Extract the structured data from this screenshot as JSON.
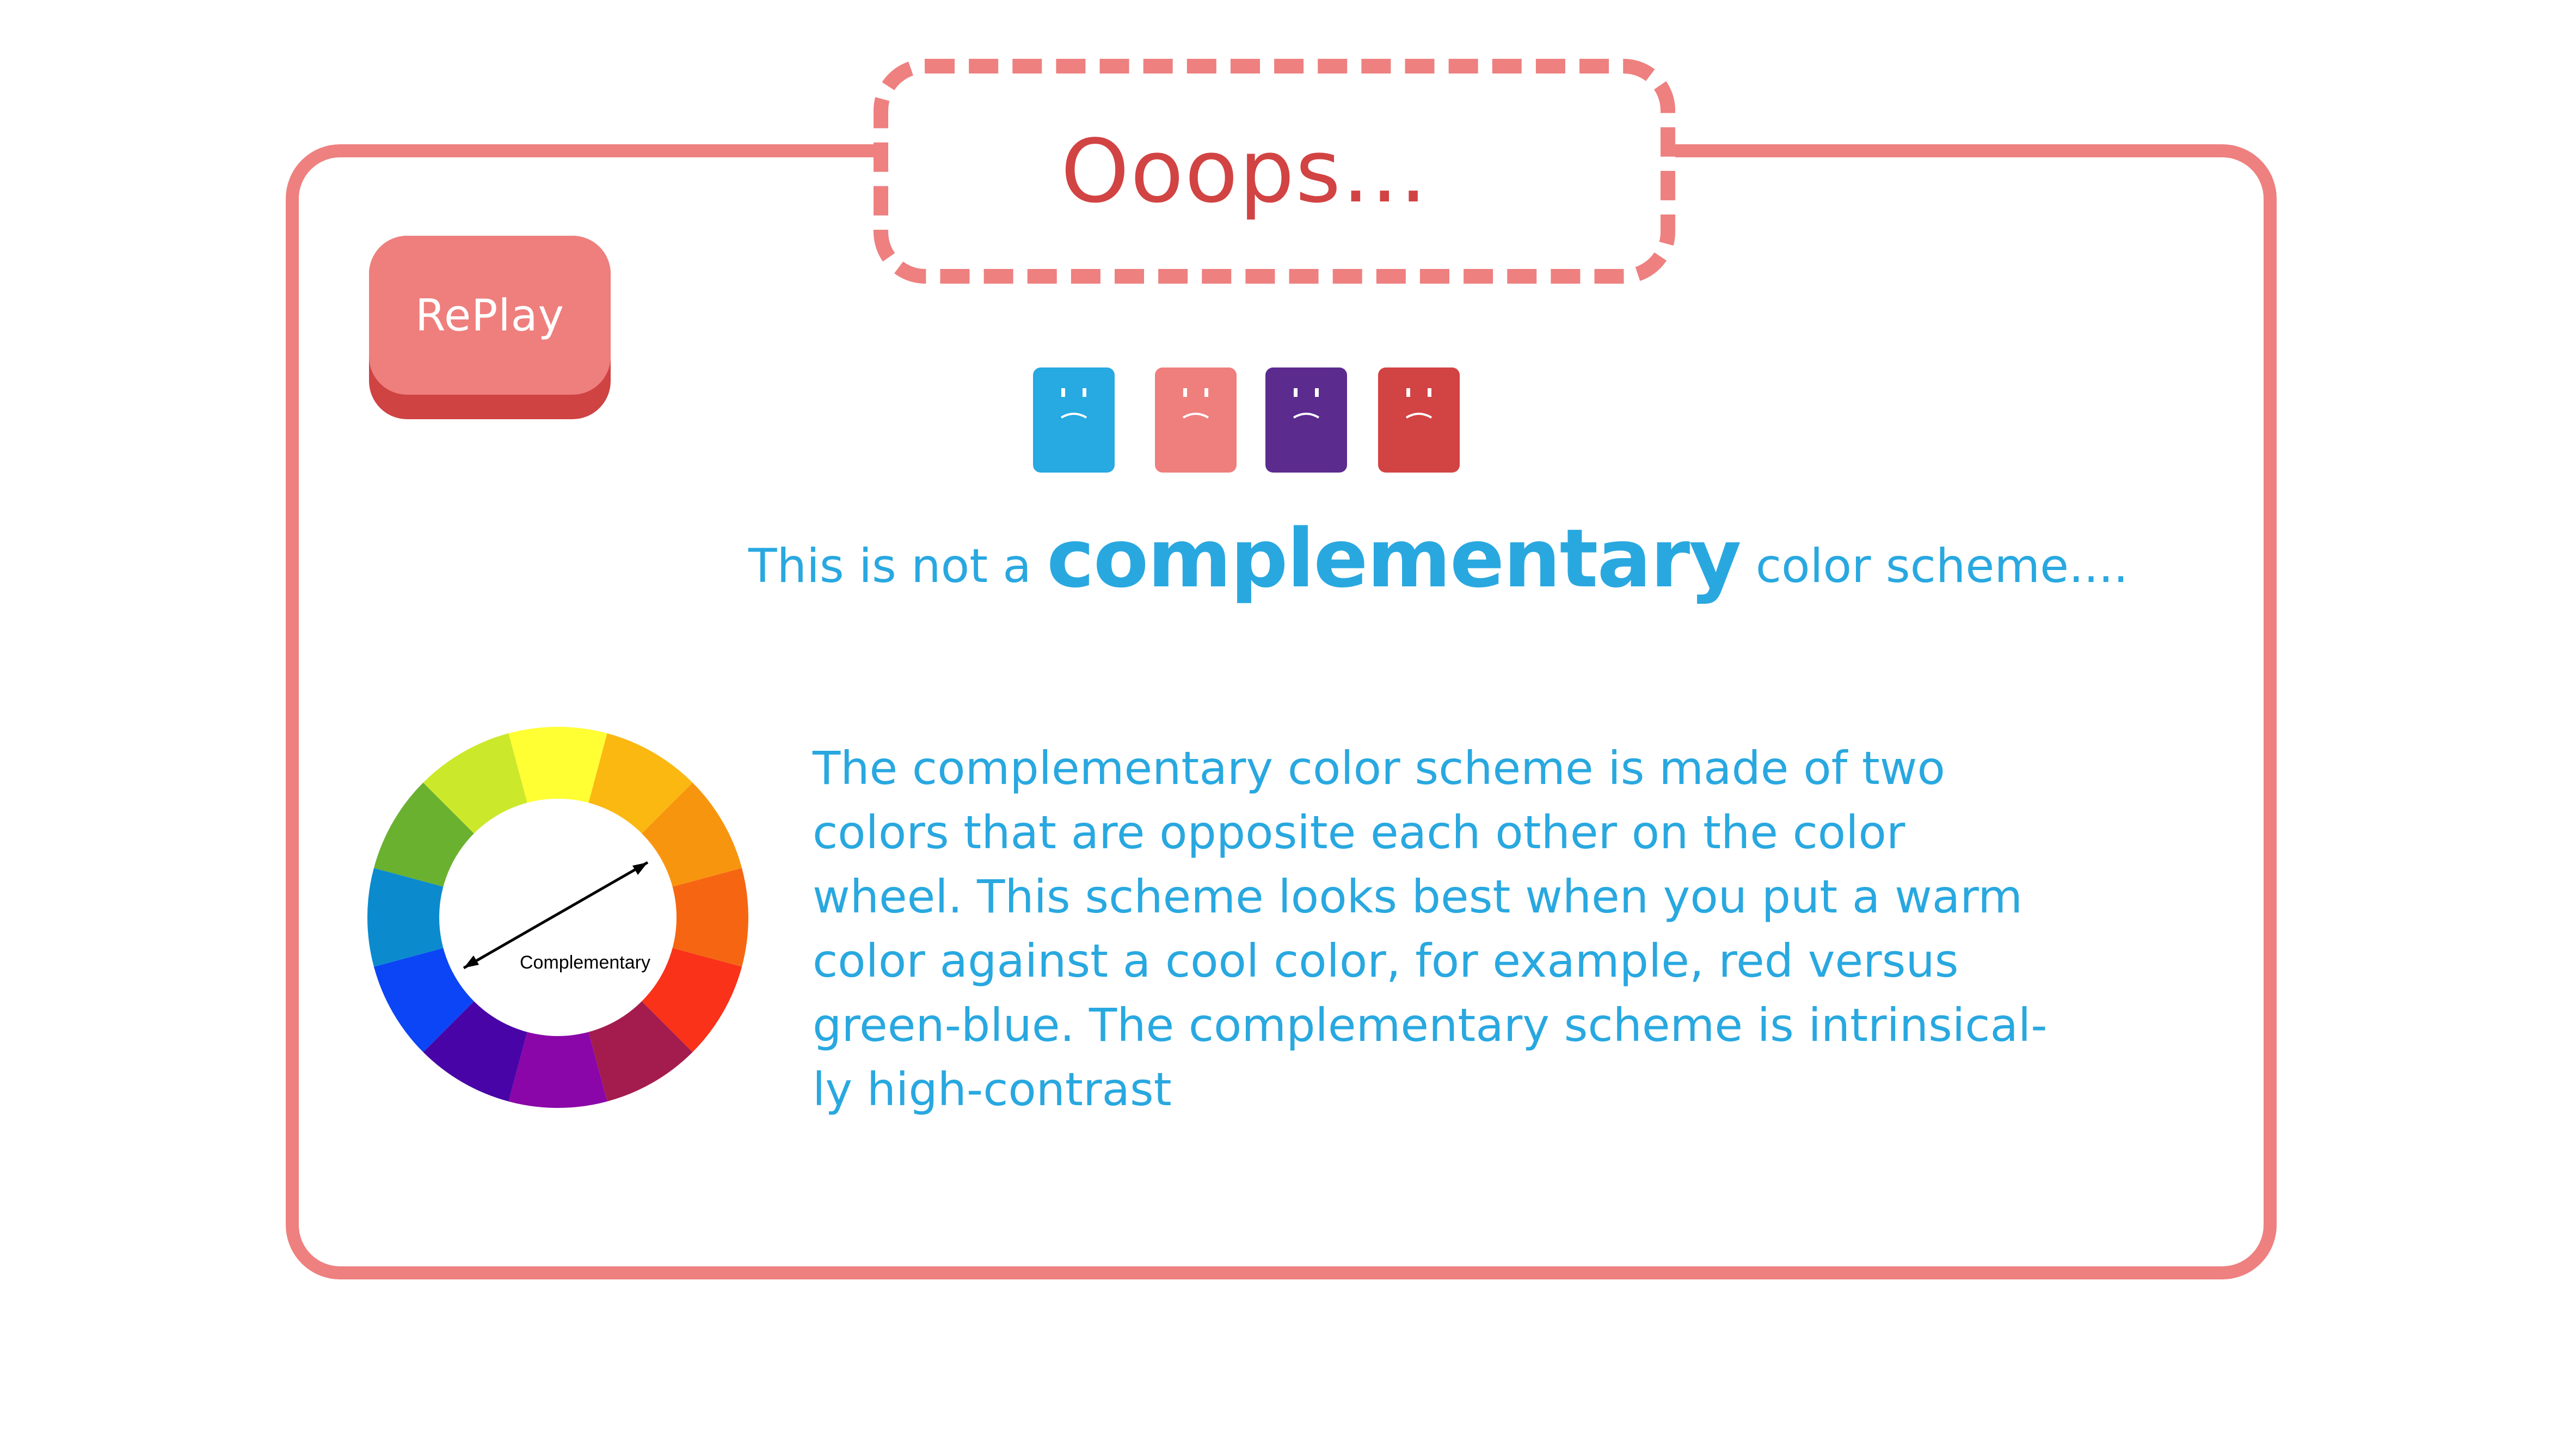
{
  "title": "Ooops...",
  "replay_button": {
    "label": "RePlay"
  },
  "colors": {
    "panel_border": "#ee8080",
    "title_text": "#d24343",
    "text_blue": "#29a8e0",
    "button_face": "#ee7f7d",
    "button_shadow": "#cf4343"
  },
  "blocks": [
    {
      "name": "sad-block-blue",
      "color": "#27a9e1",
      "face": "sad"
    },
    {
      "name": "sad-block-pink",
      "color": "#ee7f7d",
      "face": "sad"
    },
    {
      "name": "sad-block-purple",
      "color": "#5b2b8e",
      "face": "sad"
    },
    {
      "name": "sad-block-red",
      "color": "#d24343",
      "face": "sad"
    }
  ],
  "headline": {
    "before": "This is not a",
    "emphasis": "complementary",
    "after": "color scheme...."
  },
  "wheel": {
    "label": "Complementary",
    "segments": [
      "#ffff33",
      "#fbb811",
      "#f8950f",
      "#f66612",
      "#f93219",
      "#a41c4d",
      "#8a06a8",
      "#4804a6",
      "#0b45f5",
      "#0b8bce",
      "#6ab130",
      "#cbe82a"
    ]
  },
  "explanation": {
    "lines": [
      "The complementary color scheme is made of two",
      "colors that are opposite each other on the color",
      "wheel. This scheme looks best when you put a warm",
      "color against a cool color, for example, red versus",
      "green-blue. The complementary scheme is intrinsical-",
      "ly high-contrast"
    ]
  }
}
